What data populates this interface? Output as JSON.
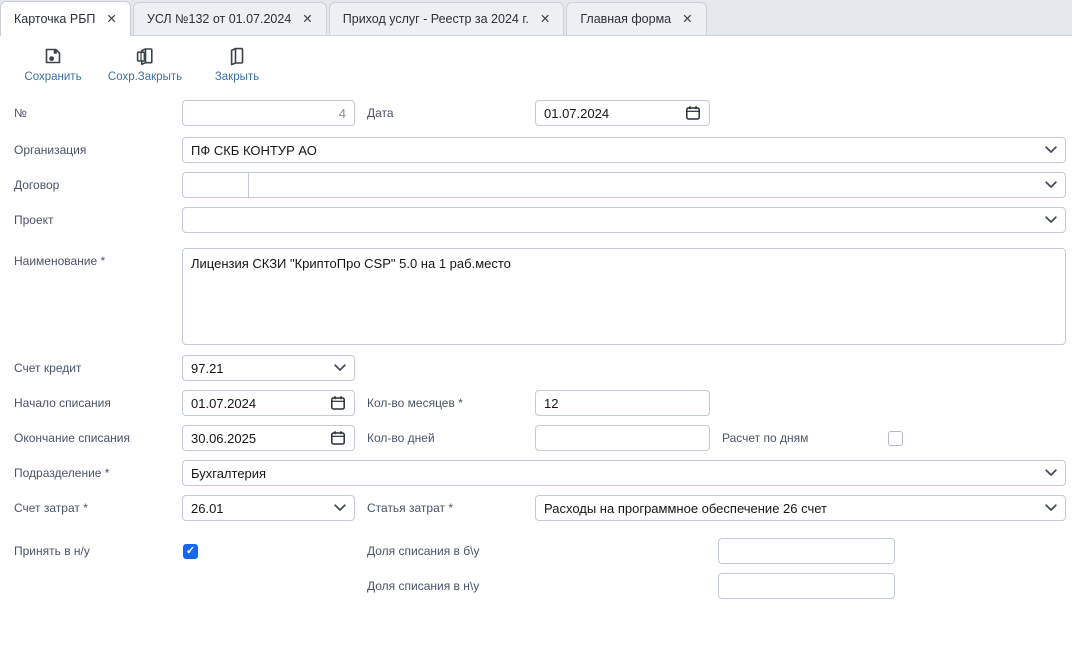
{
  "tabs": [
    {
      "label": "Карточка РБП",
      "active": true
    },
    {
      "label": "УСЛ №132 от 01.07.2024",
      "active": false
    },
    {
      "label": "Приход услуг - Реестр за 2024 г.",
      "active": false
    },
    {
      "label": "Главная форма",
      "active": false
    }
  ],
  "toolbar": {
    "save_label": "Сохранить",
    "save_close_label": "Сохр.Закрыть",
    "close_label": "Закрыть"
  },
  "form": {
    "number": {
      "label": "№",
      "value": "4"
    },
    "date": {
      "label": "Дата",
      "value": "01.07.2024"
    },
    "organization": {
      "label": "Организация",
      "value": "ПФ СКБ КОНТУР АО"
    },
    "contract": {
      "label": "Договор",
      "code_value": "",
      "value": ""
    },
    "project": {
      "label": "Проект",
      "value": ""
    },
    "name": {
      "label": "Наименование *",
      "value": "Лицензия СКЗИ \"КриптоПро CSP\" 5.0 на 1 раб.место"
    },
    "credit_account": {
      "label": "Счет кредит",
      "value": "97.21"
    },
    "start_date": {
      "label": "Начало списания",
      "value": "01.07.2024"
    },
    "months": {
      "label": "Кол-во месяцев *",
      "value": "12"
    },
    "end_date": {
      "label": "Окончание списания",
      "value": "30.06.2025"
    },
    "days": {
      "label": "Кол-во дней",
      "value": ""
    },
    "by_days": {
      "label": "Расчет по дням",
      "checked": false
    },
    "department": {
      "label": "Подразделение *",
      "value": "Бухгалтерия"
    },
    "cost_account": {
      "label": "Счет затрат *",
      "value": "26.01"
    },
    "cost_item": {
      "label": "Статья затрат *",
      "value": "Расходы на программное обеспечение 26 счет"
    },
    "tax_accept": {
      "label": "Принять в н/у",
      "checked": true
    },
    "share_bu": {
      "label": "Доля списания в б\\у",
      "value": ""
    },
    "share_nu": {
      "label": "Доля списания в н\\у",
      "value": ""
    }
  },
  "icons": {
    "check": "✓",
    "close": "✕"
  },
  "colors": {
    "accent_blue": "#3d70a2",
    "checkbox_blue": "#1668f1",
    "tab_active_bg": "#ffffff"
  }
}
